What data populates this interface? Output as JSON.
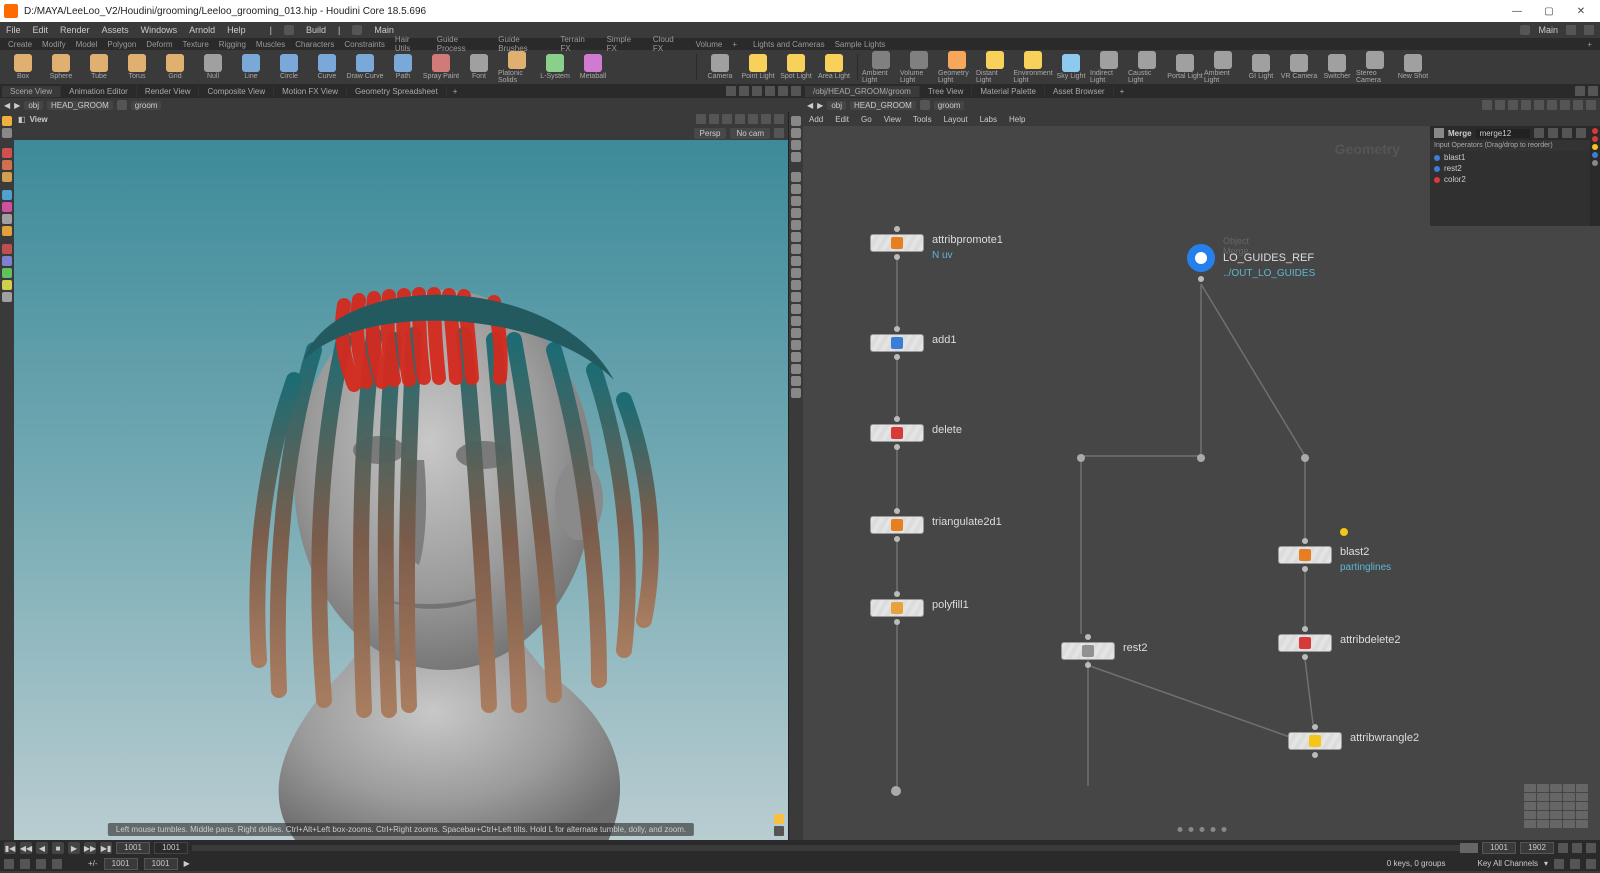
{
  "title": "D:/MAYA/LeeLoo_V2/Houdini/grooming/Leeloo_grooming_013.hip - Houdini Core 18.5.696",
  "menubar": [
    "File",
    "Edit",
    "Render",
    "Assets",
    "Windows",
    "Arnold",
    "Help"
  ],
  "menu_right": {
    "desktop": "Build",
    "layout": "Main",
    "layout_right": "Main"
  },
  "shelf_tab_rows": {
    "left": [
      "Create",
      "Modify",
      "Model",
      "Polygon",
      "Deform",
      "Texture",
      "Rigging",
      "Muscles",
      "Characters",
      "Constraints",
      "Hair Utils",
      "Guide Process",
      "Guide Brushes",
      "Terrain FX",
      "Simple FX",
      "Cloud FX",
      "Volume"
    ],
    "right": [
      "Lights and Cameras",
      "Sample Lights"
    ]
  },
  "shelves_left": [
    {
      "label": "Box",
      "color": "#e0b070"
    },
    {
      "label": "Sphere",
      "color": "#e0b070"
    },
    {
      "label": "Tube",
      "color": "#e0b070"
    },
    {
      "label": "Torus",
      "color": "#e0b070"
    },
    {
      "label": "Grid",
      "color": "#e0b070"
    },
    {
      "label": "Null",
      "color": "#a0a0a0"
    },
    {
      "label": "Line",
      "color": "#7aa8d8"
    },
    {
      "label": "Circle",
      "color": "#7aa8d8"
    },
    {
      "label": "Curve",
      "color": "#7aa8d8"
    },
    {
      "label": "Draw Curve",
      "color": "#7aa8d8"
    },
    {
      "label": "Path",
      "color": "#7aa8d8"
    },
    {
      "label": "Spray Paint",
      "color": "#d07a7a"
    },
    {
      "label": "Font",
      "color": "#a0a0a0"
    },
    {
      "label": "Platonic Solids",
      "color": "#e0b070"
    },
    {
      "label": "L-System",
      "color": "#8ad08a"
    },
    {
      "label": "Metaball",
      "color": "#d07ad0"
    }
  ],
  "shelves_right_a": [
    {
      "label": "Camera",
      "color": "#a0a0a0"
    },
    {
      "label": "Point Light",
      "color": "#f7d15a"
    },
    {
      "label": "Spot Light",
      "color": "#f7d15a"
    },
    {
      "label": "Area Light",
      "color": "#f7d15a"
    }
  ],
  "shelves_right_b": [
    {
      "label": "Ambient Light",
      "color": "#808080"
    },
    {
      "label": "Volume Light",
      "color": "#808080"
    },
    {
      "label": "Geometry Light",
      "color": "#f7a75a"
    },
    {
      "label": "Distant Light",
      "color": "#f7d15a"
    },
    {
      "label": "Environment Light",
      "color": "#f7d15a"
    },
    {
      "label": "Sky Light",
      "color": "#8ec9f0"
    },
    {
      "label": "Indirect Light",
      "color": "#a0a0a0"
    },
    {
      "label": "Caustic Light",
      "color": "#a0a0a0"
    },
    {
      "label": "Portal Light",
      "color": "#a0a0a0"
    },
    {
      "label": "Ambient Light",
      "color": "#a0a0a0"
    },
    {
      "label": "GI Light",
      "color": "#a0a0a0"
    },
    {
      "label": "VR Camera",
      "color": "#a0a0a0"
    },
    {
      "label": "Switcher",
      "color": "#a0a0a0"
    },
    {
      "label": "Stereo Camera",
      "color": "#a0a0a0"
    },
    {
      "label": "New Shot",
      "color": "#a0a0a0"
    }
  ],
  "left_pane_tabs": [
    "Scene View",
    "Animation Editor",
    "Render View",
    "Composite View",
    "Motion FX View",
    "Geometry Spreadsheet"
  ],
  "right_pane_tabs": [
    "/obj/HEAD_GROOM/groom",
    "Tree View",
    "Material Palette",
    "Asset Browser"
  ],
  "path": {
    "obj": "obj",
    "head": "HEAD_GROOM",
    "groom": "groom"
  },
  "viewport": {
    "view_label": "View",
    "persp": "Persp",
    "cam": "No cam",
    "hint": "Left mouse tumbles. Middle pans. Right dollies. Ctrl+Alt+Left box-zooms. Ctrl+Right zooms. Spacebar+Ctrl+Left tilts. Hold L for alternate tumble, dolly, and zoom."
  },
  "net_menu": [
    "Add",
    "Edit",
    "Go",
    "View",
    "Tools",
    "Layout",
    "Labs",
    "Help"
  ],
  "geo_label": "Geometry",
  "nodes": {
    "attribpromote": {
      "label": "attribpromote1",
      "sub": "N uv"
    },
    "add": {
      "label": "add1"
    },
    "delete": {
      "label": "delete"
    },
    "triangulate": {
      "label": "triangulate2d1"
    },
    "polyfill": {
      "label": "polyfill1"
    },
    "rest": {
      "label": "rest2"
    },
    "loguides": {
      "label": "LO_GUIDES_REF",
      "sub": "../OUT_LO_GUIDES",
      "tag": "Object Merge"
    },
    "blast": {
      "label": "blast2",
      "sub": "partinglines"
    },
    "attribdelete": {
      "label": "attribdelete2"
    },
    "attribwrangle": {
      "label": "attribwrangle2"
    }
  },
  "param": {
    "node_type": "Merge",
    "node_name": "merge12",
    "sub": "Input Operators (Drag/drop to reorder)",
    "inputs": [
      {
        "name": "blast1",
        "color": "#3a7ed8"
      },
      {
        "name": "rest2",
        "color": "#3a7ed8"
      },
      {
        "name": "color2",
        "color": "#d83a3a"
      }
    ]
  },
  "timeline": {
    "frame": "1001",
    "start": "1001",
    "end": "1902",
    "cur": "1001"
  },
  "status": {
    "keys": "0 keys, 0 groups",
    "mode": "Key All Channels"
  }
}
